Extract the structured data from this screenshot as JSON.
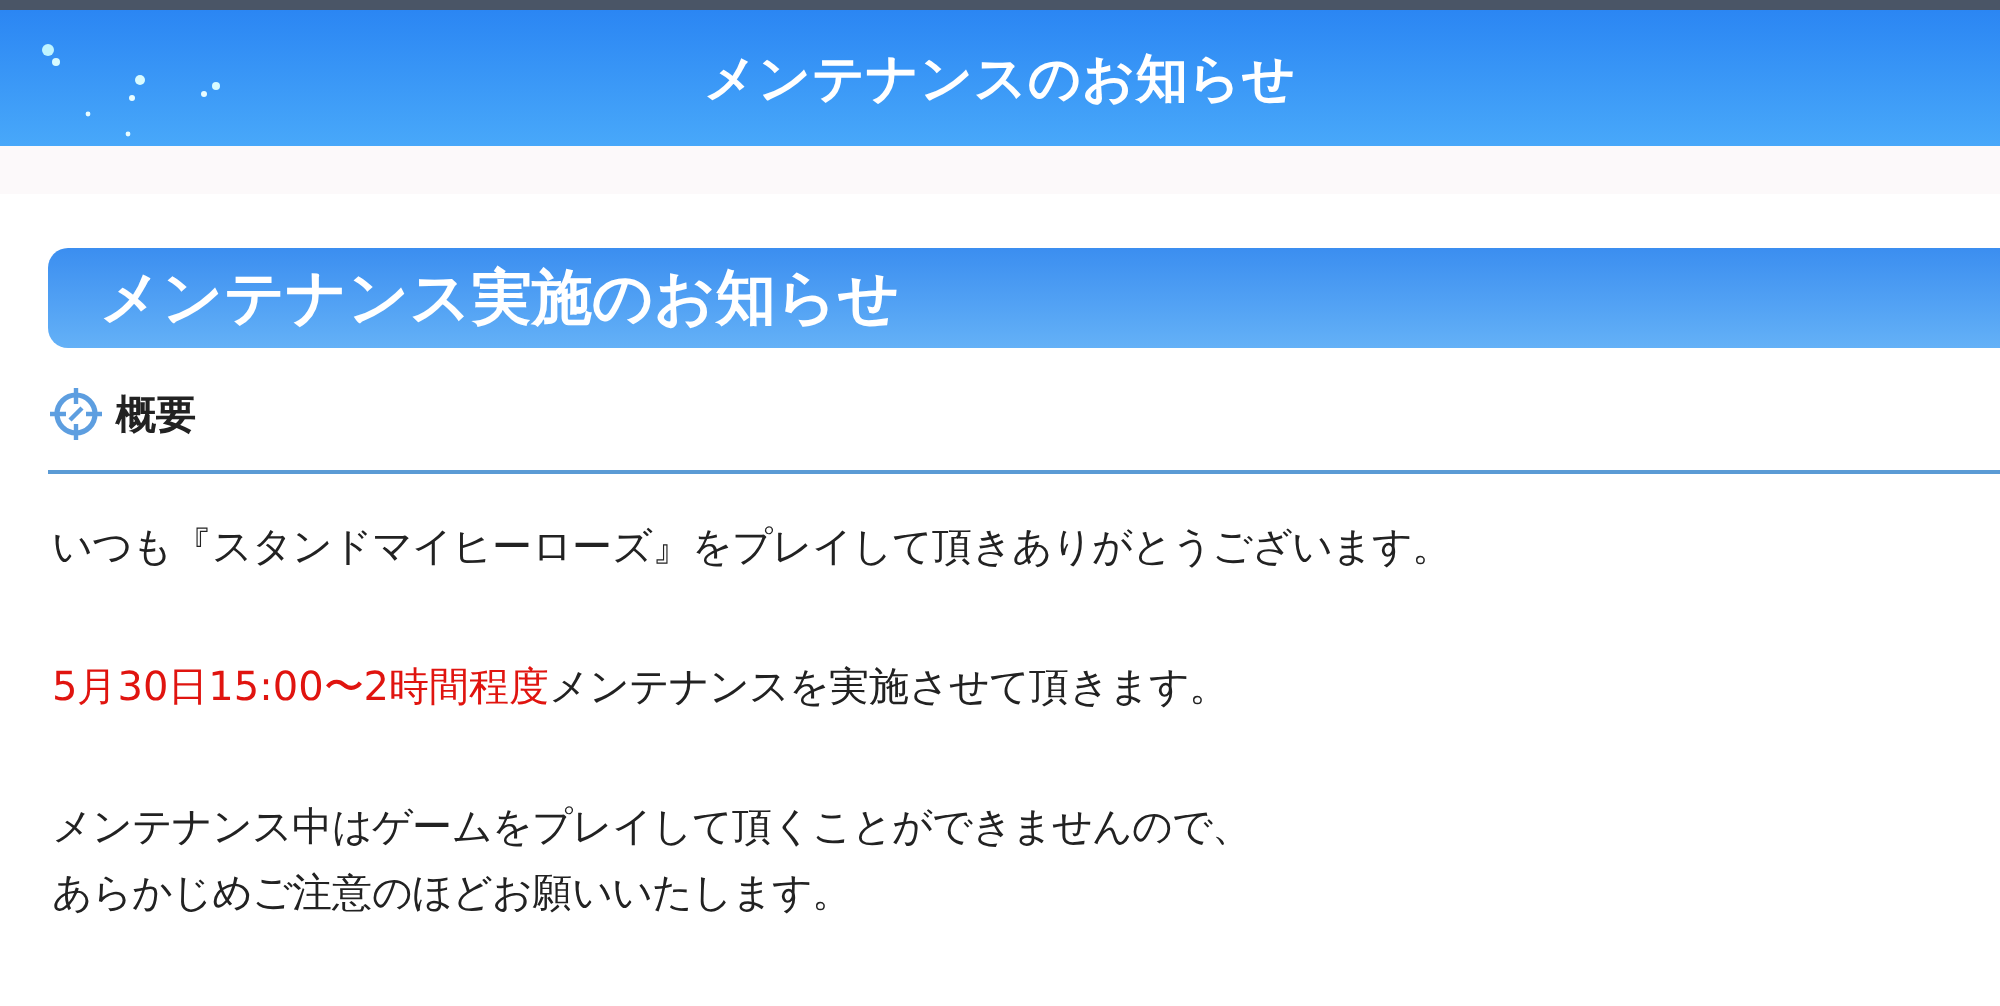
{
  "header": {
    "title": "メンテナンスのお知らせ"
  },
  "banner": {
    "title": "メンテナンス実施のお知らせ"
  },
  "section": {
    "heading": "概要"
  },
  "paragraphs": [
    {
      "lines": [
        [
          {
            "text": "いつも『スタンドマイヒーローズ』をプレイして頂きありがとうございます。",
            "kind": "plain"
          }
        ]
      ]
    },
    {
      "lines": [
        [
          {
            "text": "5月30日15:00〜2時間程度",
            "kind": "highlight"
          },
          {
            "text": "メンテナンスを実施させて頂きます。",
            "kind": "plain"
          }
        ]
      ]
    },
    {
      "lines": [
        [
          {
            "text": "メンテナンス中はゲームをプレイして頂くことができませんので、",
            "kind": "plain"
          }
        ],
        [
          {
            "text": "あらかじめご注意のほどお願いいたします。",
            "kind": "plain"
          }
        ]
      ]
    }
  ]
}
